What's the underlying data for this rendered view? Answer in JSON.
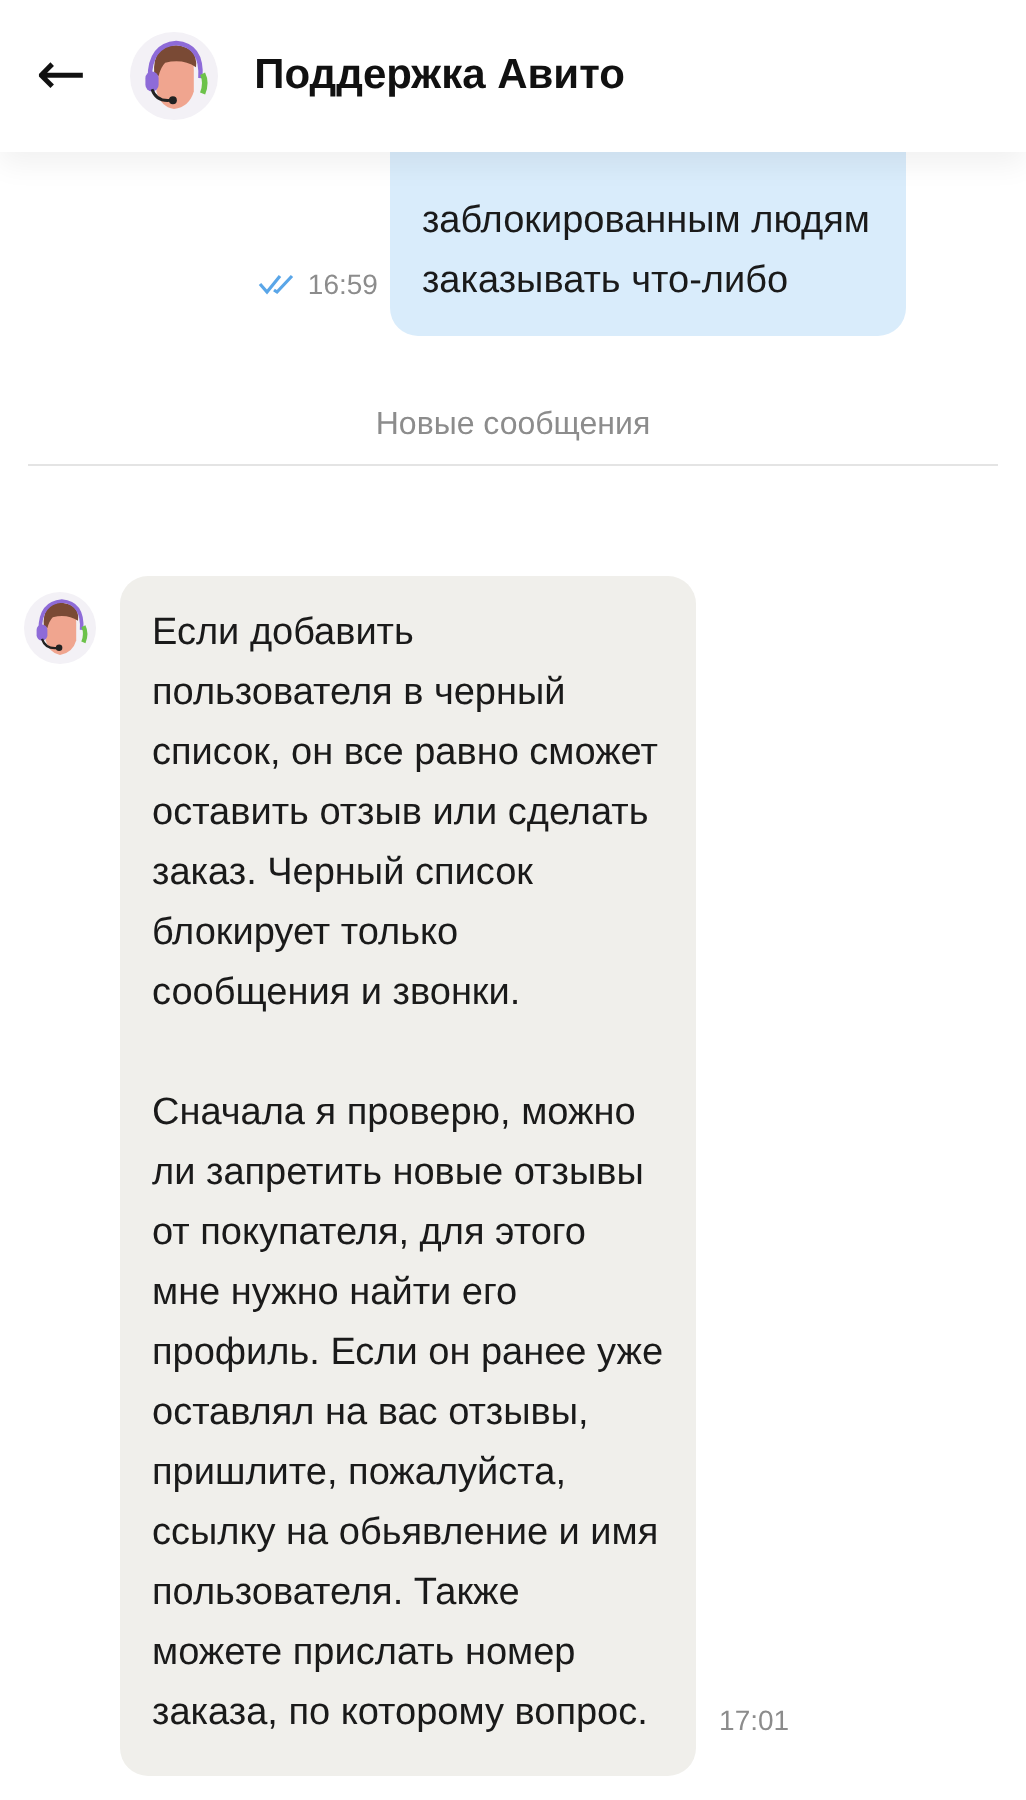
{
  "header": {
    "back": "←",
    "title": "Поддержка Авито"
  },
  "messages": [
    {
      "kind": "outgoing",
      "text": "заблокированным людям\nзаказывать что-либо",
      "time": "16:59",
      "read": true
    },
    {
      "kind": "divider",
      "text": "Новые сообщения"
    },
    {
      "kind": "incoming",
      "text": "Если добавить\nпользователя в черный\nсписок, он все равно сможет\nоставить отзыв или сделать\nзаказ. Черный список\nблокирует только\nсообщения и звонки.\n\nСначала я проверю, можно\nли запретить новые отзывы\nот покупателя, для этого\nмне нужно найти его\nпрофиль. Если он ранее уже\nоставлял на вас отзывы,\nпришлите, пожалуйста,\nссылку на обьявление и имя\nпользователя. Также\nможете прислать номер\nзаказа, по которому вопрос.",
      "time": "17:01"
    }
  ]
}
